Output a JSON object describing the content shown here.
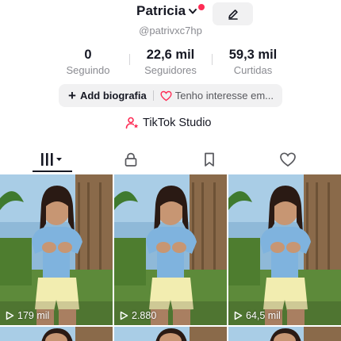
{
  "profile": {
    "name": "Patricia",
    "handle": "@patrivxc7hp"
  },
  "stats": [
    {
      "value": "0",
      "label": "Seguindo"
    },
    {
      "value": "22,6 mil",
      "label": "Seguidores"
    },
    {
      "value": "59,3 mil",
      "label": "Curtidas"
    }
  ],
  "bio": {
    "add_label": "Add biografia",
    "interest_label": "Tenho interesse em..."
  },
  "studio": {
    "label": "TikTok Studio"
  },
  "tabs": [
    {
      "icon": "videos-grid-icon",
      "active": true
    },
    {
      "icon": "lock-icon",
      "active": false
    },
    {
      "icon": "bookmark-icon",
      "active": false
    },
    {
      "icon": "heart-icon",
      "active": false
    }
  ],
  "videos": [
    {
      "views": "179 mil"
    },
    {
      "views": "2.880"
    },
    {
      "views": "64,5 mil"
    }
  ],
  "colors": {
    "accent": "#fe2c55",
    "text": "#161823",
    "secondary": "#8a8b91",
    "pill": "#f1f1f2"
  }
}
